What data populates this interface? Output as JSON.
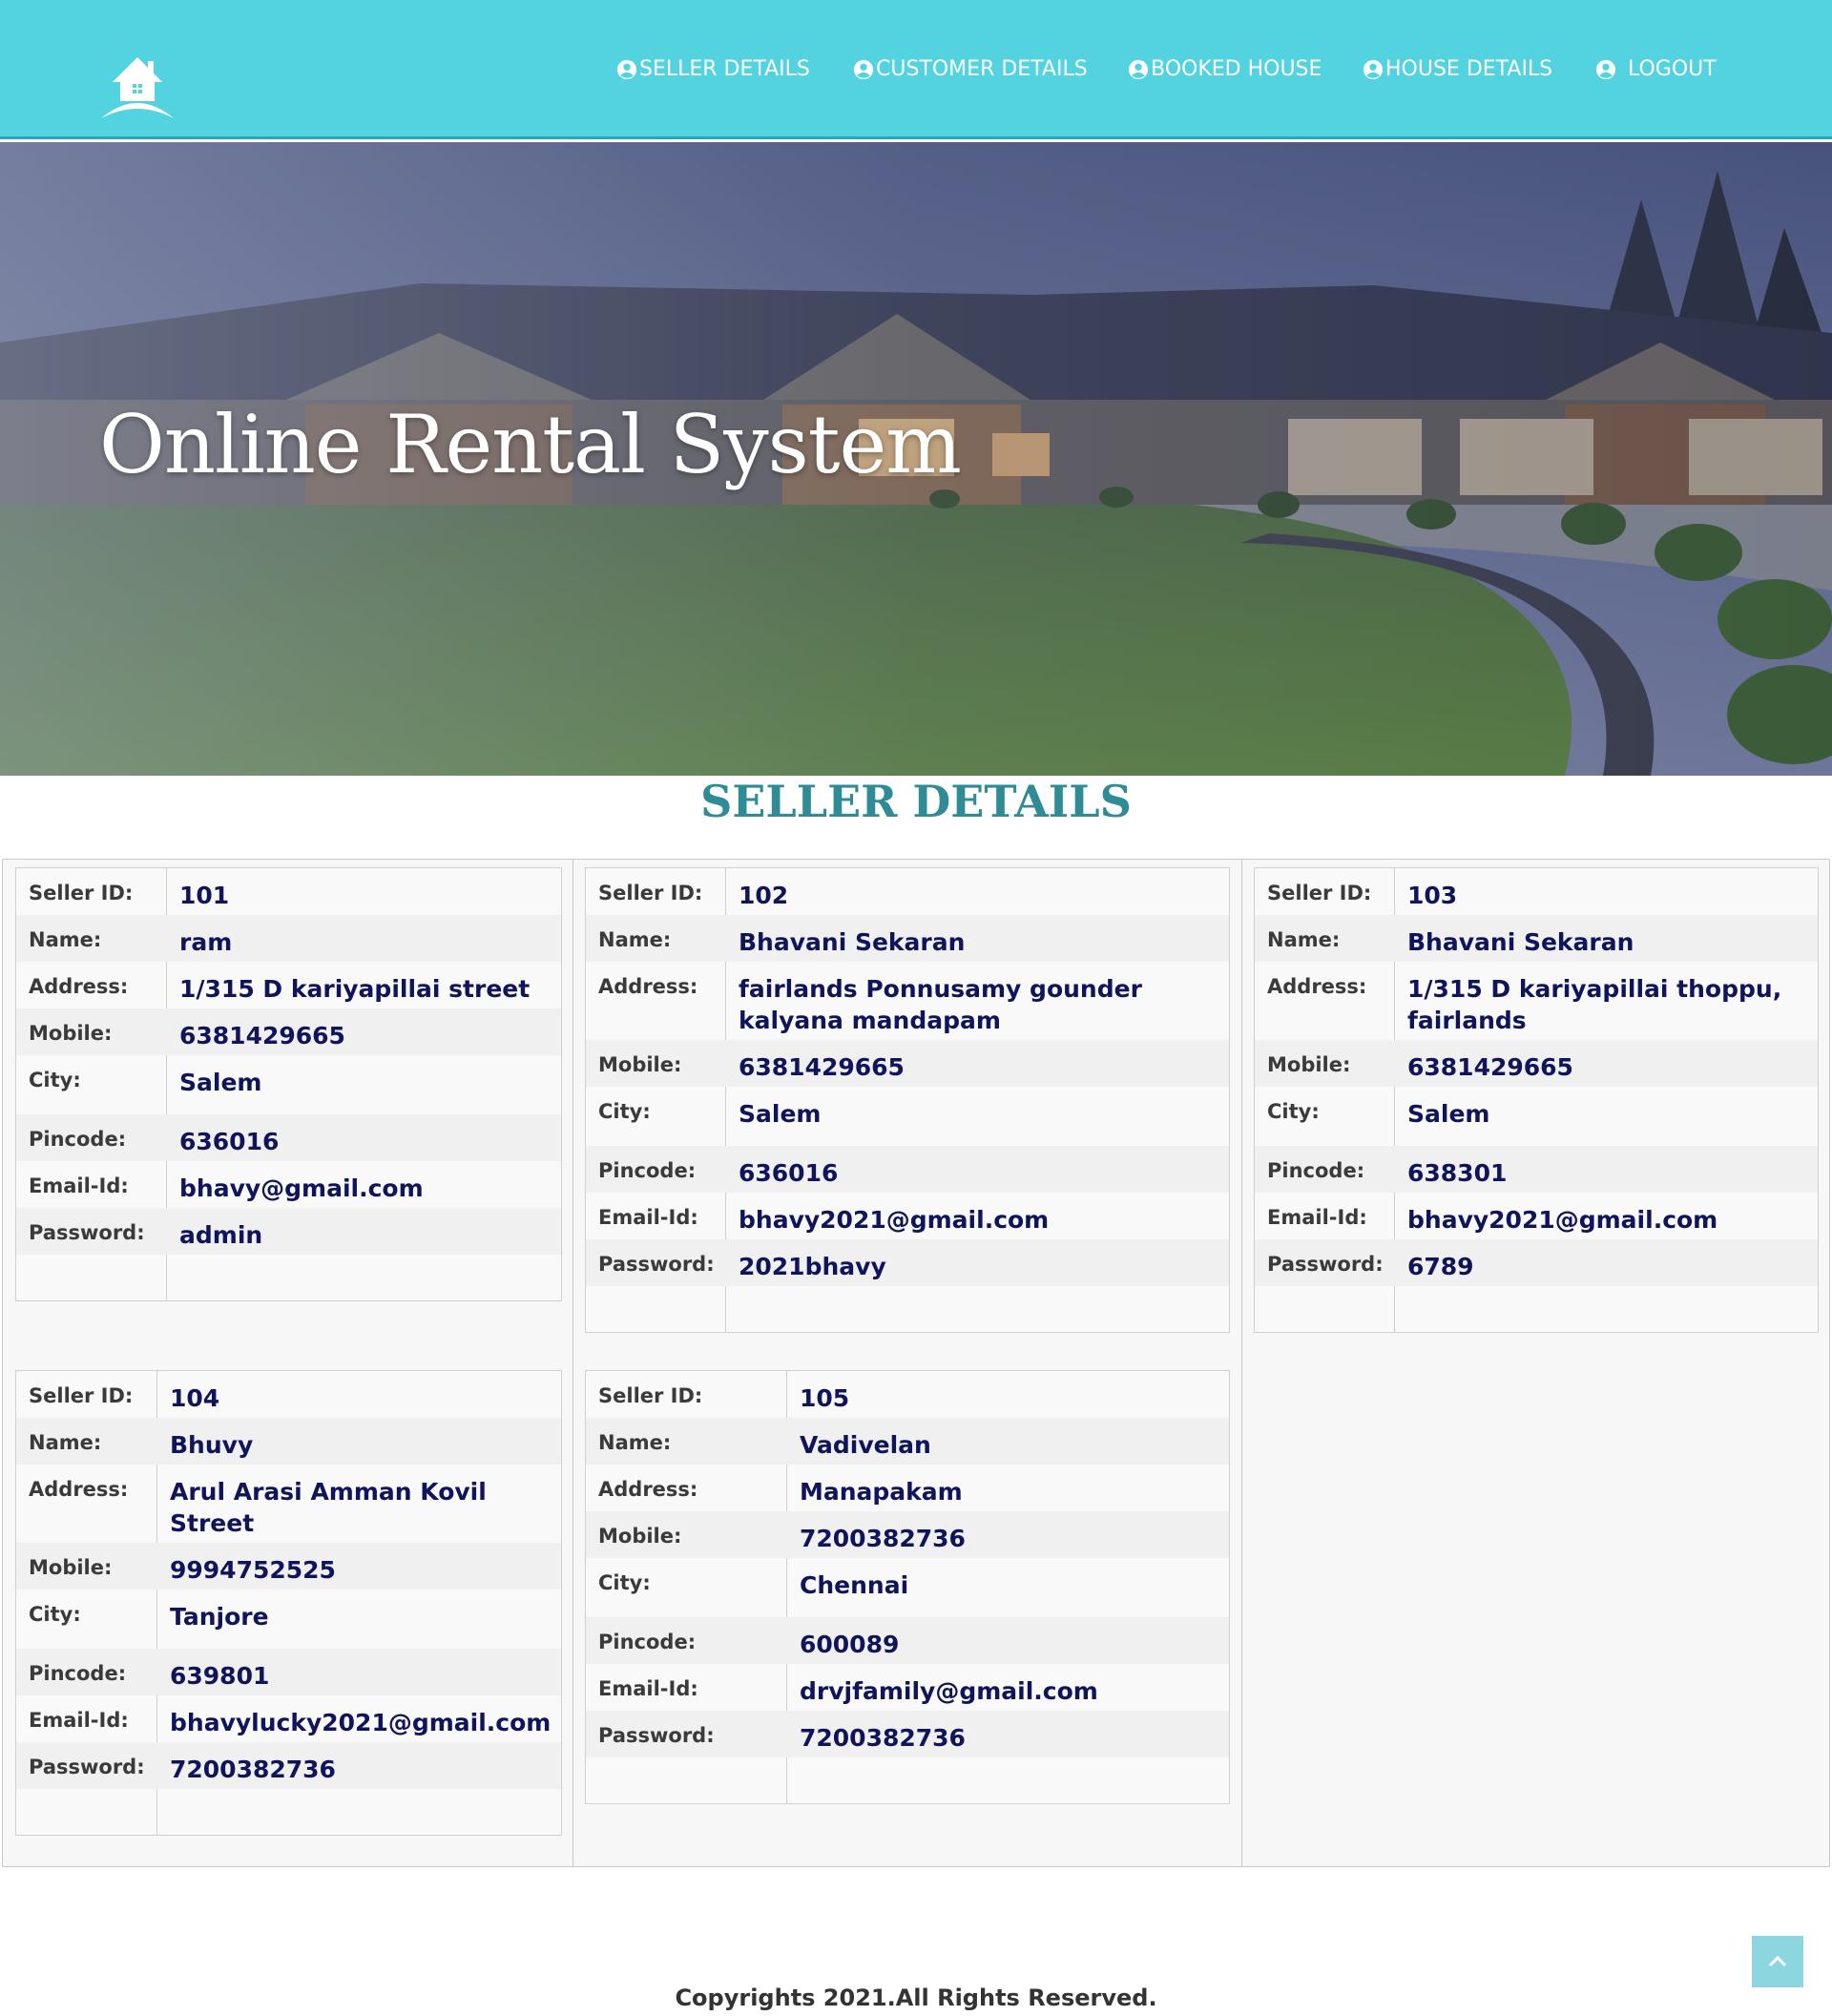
{
  "nav": {
    "items": [
      {
        "label": "SELLER DETAILS",
        "icon": "user-circle-icon"
      },
      {
        "label": "CUSTOMER DETAILS",
        "icon": "user-circle-icon"
      },
      {
        "label": "BOOKED HOUSE",
        "icon": "user-circle-icon"
      },
      {
        "label": "HOUSE DETAILS",
        "icon": "user-circle-icon"
      },
      {
        "label": "LOGOUT",
        "icon": "user-circle-icon"
      }
    ]
  },
  "hero": {
    "title": "Online Rental System"
  },
  "section": {
    "title": "SELLER DETAILS"
  },
  "labels": {
    "seller_id": "Seller ID:",
    "name": "Name:",
    "address": "Address:",
    "mobile": "Mobile:",
    "city": "City:",
    "pincode": "Pincode:",
    "email": "Email-Id:",
    "password": "Password:"
  },
  "sellers": [
    {
      "seller_id": "101",
      "name": "ram",
      "address": "1/315 D kariyapillai street",
      "mobile": "6381429665",
      "city": "Salem",
      "pincode": "636016",
      "email": "bhavy@gmail.com",
      "password": "admin"
    },
    {
      "seller_id": "102",
      "name": "Bhavani Sekaran",
      "address": "fairlands Ponnusamy gounder kalyana mandapam",
      "mobile": "6381429665",
      "city": "Salem",
      "pincode": "636016",
      "email": "bhavy2021@gmail.com",
      "password": "2021bhavy"
    },
    {
      "seller_id": "103",
      "name": "Bhavani Sekaran",
      "address": "1/315 D kariyapillai thoppu, fairlands",
      "mobile": "6381429665",
      "city": "Salem",
      "pincode": "638301",
      "email": "bhavy2021@gmail.com",
      "password": "6789"
    },
    {
      "seller_id": "104",
      "name": "Bhuvy",
      "address": "Arul Arasi Amman Kovil Street",
      "mobile": "9994752525",
      "city": "Tanjore",
      "pincode": "639801",
      "email": "bhavylucky2021@gmail.com",
      "password": "7200382736"
    },
    {
      "seller_id": "105",
      "name": "Vadivelan",
      "address": "Manapakam",
      "mobile": "7200382736",
      "city": "Chennai",
      "pincode": "600089",
      "email": "drvjfamily@gmail.com",
      "password": "7200382736"
    }
  ],
  "footer": {
    "copyright": "Copyrights 2021.All Rights Reserved."
  },
  "colors": {
    "header_bg": "#52d3df",
    "section_title": "#2f8b96",
    "value_text": "#10145a",
    "back_to_top": "#8cd6e0"
  }
}
